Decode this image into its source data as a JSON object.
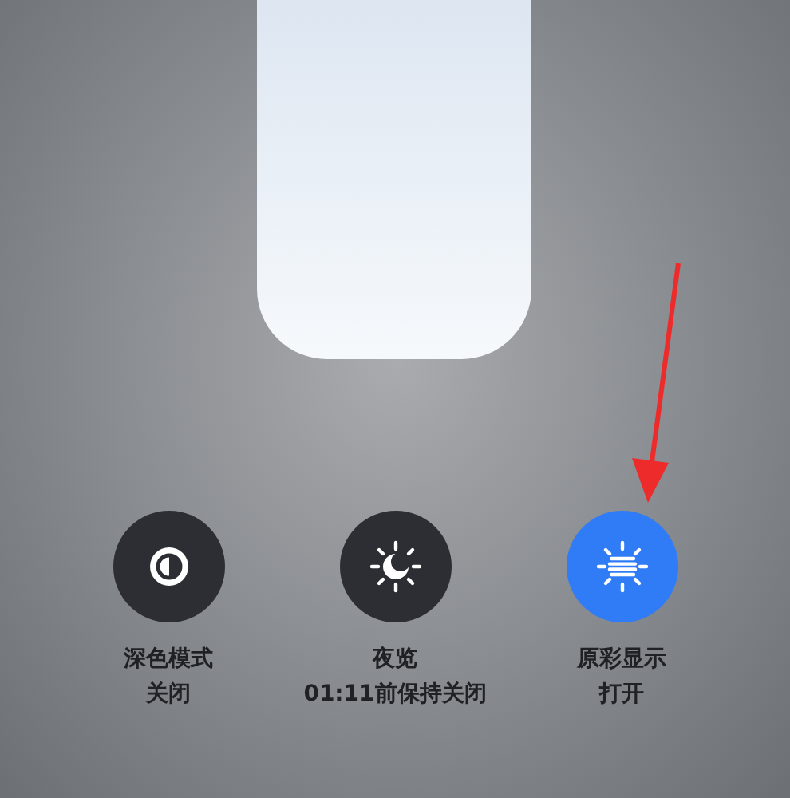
{
  "toggles": [
    {
      "kind": "dark-mode",
      "label": "深色模式",
      "status": "关闭",
      "on": false
    },
    {
      "kind": "night-shift",
      "label": "夜览",
      "status": "01:11前保持关闭",
      "on": false
    },
    {
      "kind": "true-tone",
      "label": "原彩显示",
      "status": "打开",
      "on": true
    }
  ]
}
